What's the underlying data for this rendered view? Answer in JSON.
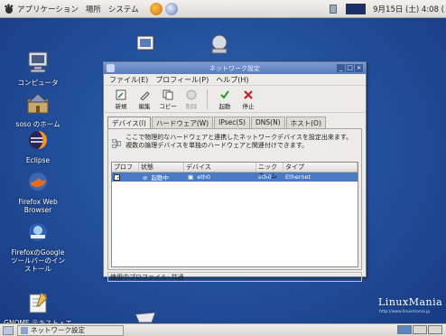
{
  "top_panel": {
    "menus": [
      "アプリケーション",
      "場所",
      "システム"
    ],
    "clock": "9月15日 (土)  4:08 ("
  },
  "desktop_icons": [
    {
      "label": "コンピュータ",
      "icon": "computer-icon"
    },
    {
      "label": "soso のホーム",
      "icon": "home-folder-icon"
    },
    {
      "label": "Eclipse",
      "icon": "eclipse-icon"
    },
    {
      "label": "Firefox Web Browser",
      "icon": "firefox-icon"
    },
    {
      "label": "FirefoxのGoogle ツールバーのインストール",
      "icon": "google-toolbar-icon"
    },
    {
      "label": "GNOME テキスト・エ",
      "icon": "text-editor-icon"
    }
  ],
  "window": {
    "title": "ネットワーク設定",
    "menus": [
      "ファイル(E)",
      "プロフィール(P)",
      "ヘルプ(H)"
    ],
    "toolbar": {
      "new": "新規",
      "edit": "編集",
      "copy": "コピー",
      "delete": "削除",
      "activate": "起動",
      "deactivate": "停止"
    },
    "tabs": [
      "デバイス(I)",
      "ハードウェア(W)",
      "IPsec(S)",
      "DNS(N)",
      "ホスト(O)"
    ],
    "description": "ここで物理的なハードウェアと連携したネットワークデバイスを設定出来ます。複数の論理デバイスを単独のハードウェアと関連付けできます。",
    "columns": [
      "プロフ",
      "状態",
      "デバイス",
      "ニックネーム",
      "タイプ"
    ],
    "rows": [
      {
        "profile_checked": "✓",
        "status": "起動中",
        "device": "eth0",
        "nickname": "eth0",
        "type": "Ethernet"
      }
    ],
    "status_bar": "使用中プロファイル: 共通"
  },
  "taskbar": {
    "task_label": "ネットワーク設定"
  },
  "watermark": "LinuxMania",
  "watermark_url": "http://www.linuxmania.jp"
}
